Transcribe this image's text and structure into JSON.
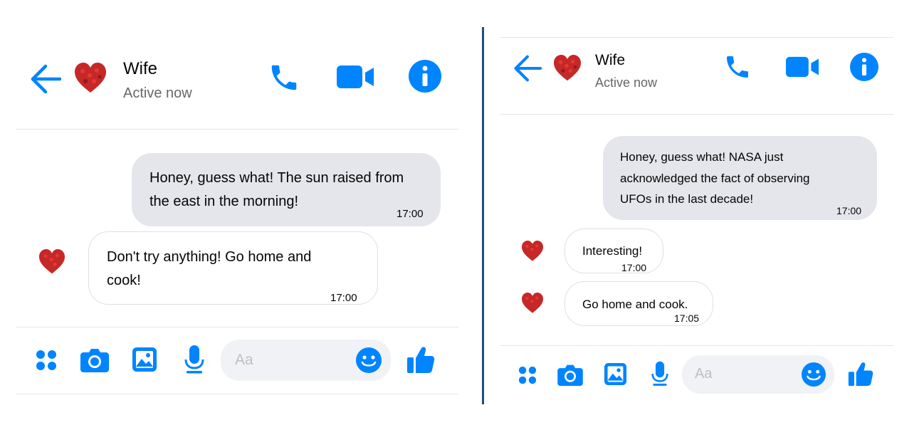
{
  "colors": {
    "accent": "#0084ff",
    "heart": "#c62828",
    "divider": "#1f4e79"
  },
  "left": {
    "header": {
      "name": "Wife",
      "status": "Active now"
    },
    "messages": [
      {
        "direction": "outgoing",
        "text_line1": "Honey, guess what! The sun raised from",
        "text_line2": "the east in the morning!",
        "time": "17:00"
      },
      {
        "direction": "incoming",
        "text_line1": "Don't try anything! Go home and",
        "text_line2": "cook!",
        "time": "17:00"
      }
    ],
    "composer": {
      "placeholder": "Aa"
    },
    "icons": [
      "back-arrow-icon",
      "phone-icon",
      "video-icon",
      "info-icon",
      "menu-dots-icon",
      "camera-icon",
      "image-icon",
      "microphone-icon",
      "emoji-icon",
      "thumbs-up-icon"
    ]
  },
  "right": {
    "header": {
      "name": "Wife",
      "status": "Active now"
    },
    "messages": [
      {
        "direction": "outgoing",
        "text_line1": "Honey, guess what! NASA just",
        "text_line2": "acknowledged the fact of observing",
        "text_line3": "UFOs in the last decade!",
        "time": "17:00"
      },
      {
        "direction": "incoming",
        "text": "Interesting!",
        "time": "17:00"
      },
      {
        "direction": "incoming",
        "text": "Go home and cook.",
        "time": "17:05"
      }
    ],
    "composer": {
      "placeholder": "Aa"
    }
  }
}
